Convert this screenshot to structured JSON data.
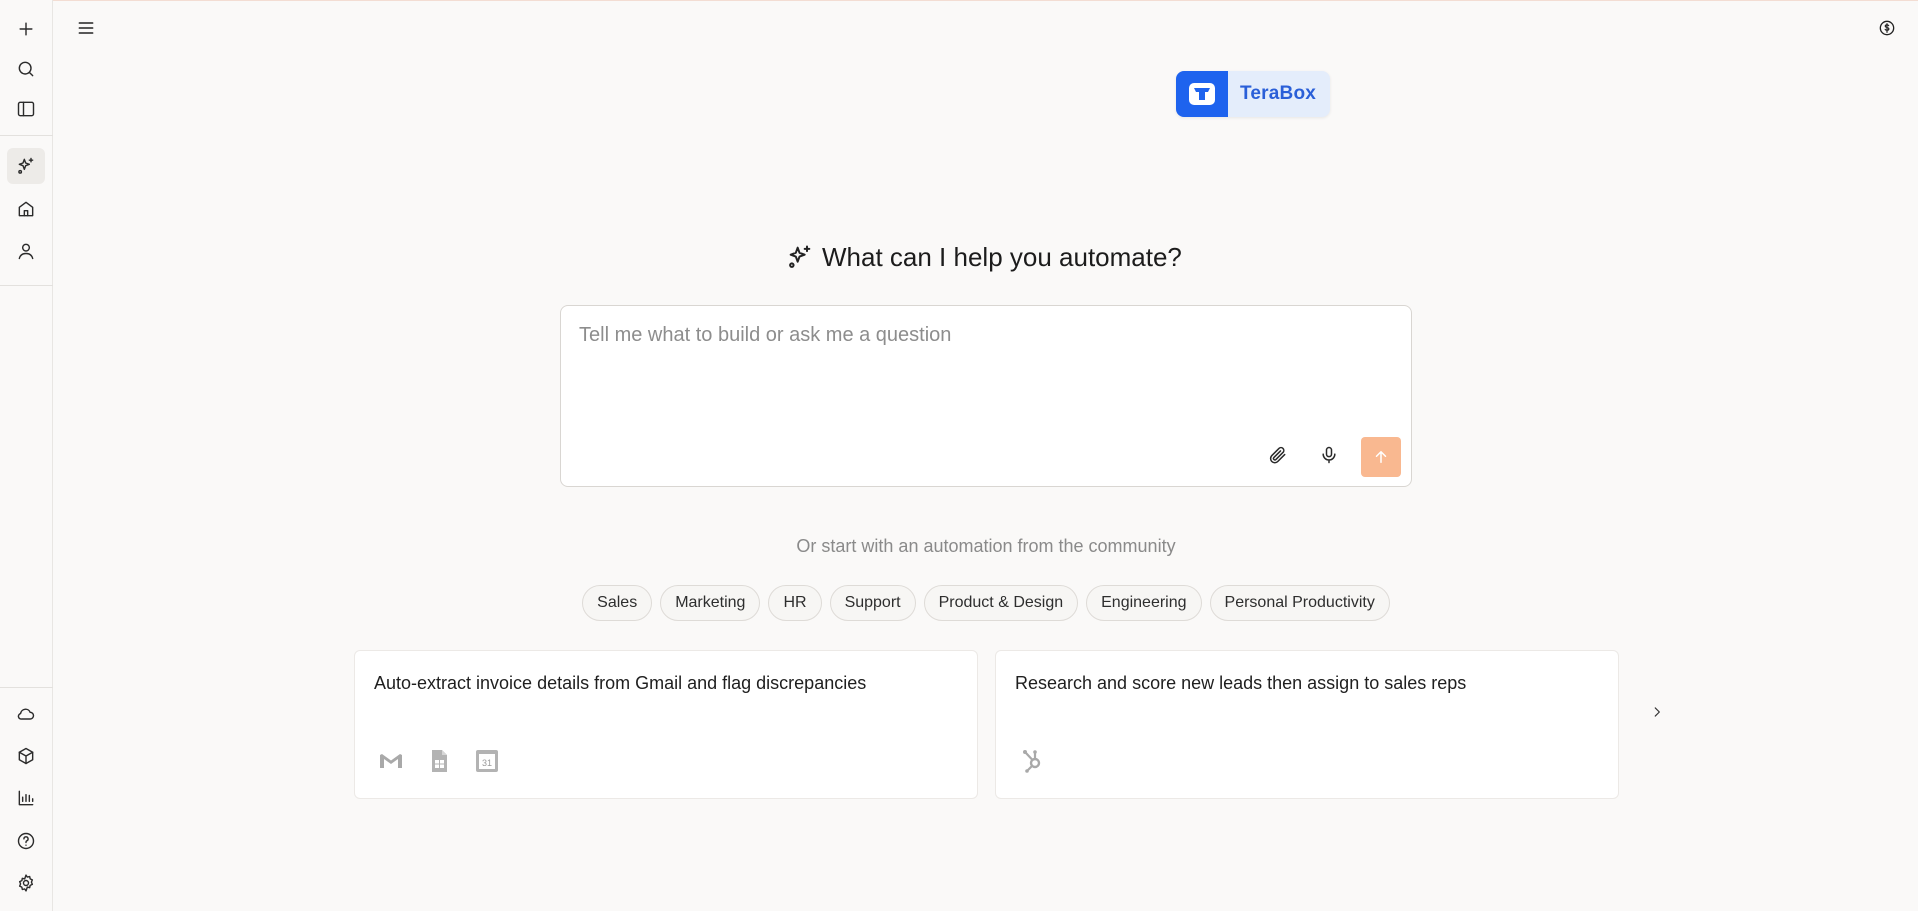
{
  "sidebar": {
    "items": [
      {
        "name": "plus-icon",
        "label": "New"
      },
      {
        "name": "search-icon",
        "label": "Search"
      },
      {
        "name": "sidebar-panel-icon",
        "label": "Panel"
      },
      {
        "name": "sparkle-icon",
        "label": "Automate"
      },
      {
        "name": "home-icon",
        "label": "Home"
      },
      {
        "name": "user-icon",
        "label": "Profile"
      },
      {
        "name": "cloud-icon",
        "label": "Cloud"
      },
      {
        "name": "package-icon",
        "label": "Packages"
      },
      {
        "name": "bar-chart-icon",
        "label": "Analytics"
      },
      {
        "name": "help-icon",
        "label": "Help"
      },
      {
        "name": "gear-icon",
        "label": "Settings"
      }
    ]
  },
  "header": {
    "menu_icon": "hamburger-icon",
    "credits_icon": "dollar-circle-icon"
  },
  "promo": {
    "brand": "TeraBox",
    "brand_color": "#1e63ee"
  },
  "main": {
    "headline": "What can I help you automate?",
    "prompt_placeholder": "Tell me what to build or ask me a question",
    "attach_icon": "paperclip-icon",
    "mic_icon": "microphone-icon",
    "send_icon": "arrow-up-icon",
    "accent_color": "#f9b890",
    "community_text": "Or start with an automation from the community",
    "categories": [
      "Sales",
      "Marketing",
      "HR",
      "Support",
      "Product & Design",
      "Engineering",
      "Personal Productivity"
    ],
    "cards": [
      {
        "title": "Auto-extract invoice details from Gmail and flag discrepancies",
        "apps": [
          "gmail-icon",
          "google-sheets-icon",
          "google-calendar-icon"
        ]
      },
      {
        "title": "Research and score new leads then assign to sales reps",
        "apps": [
          "hubspot-icon"
        ]
      }
    ],
    "next_icon": "chevron-right-icon"
  }
}
